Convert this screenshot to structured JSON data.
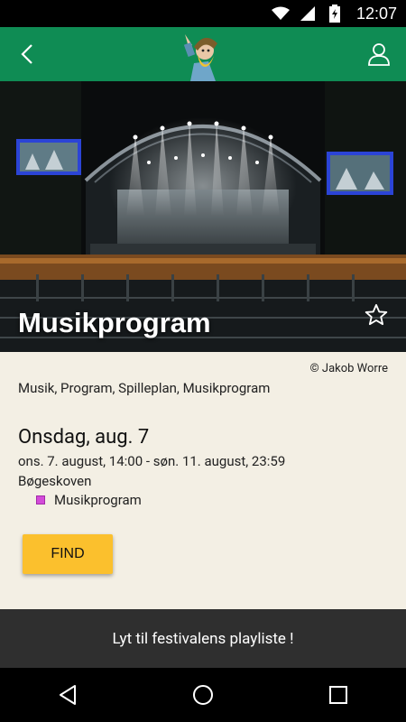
{
  "status_bar": {
    "time": "12:07",
    "icons": [
      "wifi-icon",
      "signal-icon",
      "battery-icon"
    ]
  },
  "app_bar": {
    "back_icon": "chevron-left-icon",
    "logo_icon": "festival-mascot-logo",
    "profile_icon": "user-icon",
    "color": "#0f8c54"
  },
  "hero": {
    "title": "Musikprogram",
    "favorite_icon": "star-outline-icon"
  },
  "details": {
    "photo_credit": "© Jakob Worre",
    "tags": "Musik, Program, Spilleplan, Musikprogram",
    "day_title": "Onsdag, aug. 7",
    "date_range": "ons. 7. august, 14:00 - søn. 11. august, 23:59",
    "location": "Bøgeskoven",
    "category": "Musikprogram",
    "category_color": "#d34bd9",
    "find_label": "FIND",
    "find_color": "#fbc02d"
  },
  "playlist": {
    "label": "Lyt til festivalens playliste !"
  },
  "nav_bar": {
    "icons": [
      "back-triangle-icon",
      "home-circle-icon",
      "recents-square-icon"
    ]
  }
}
